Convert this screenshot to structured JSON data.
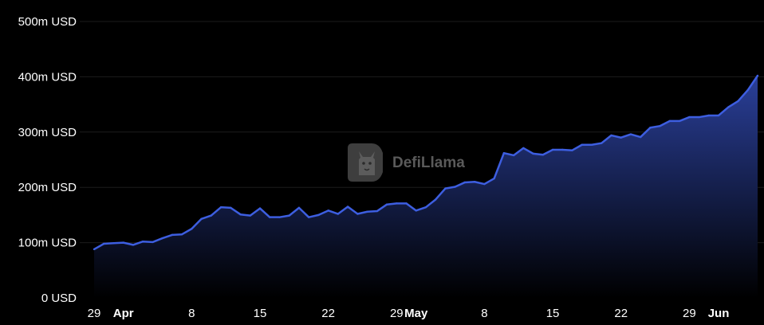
{
  "watermark": {
    "text": "DefiLlama",
    "icon": "llama-logo-icon"
  },
  "colors": {
    "background": "#000000",
    "line": "#3d5ee0",
    "area_top": "#2a3f99",
    "area_bottom": "#000000",
    "text": "#ffffff",
    "grid": "#1c1c1c"
  },
  "chart_data": {
    "type": "area",
    "title": "",
    "xlabel": "",
    "ylabel": "",
    "unit": "USD",
    "ylim": [
      0,
      500
    ],
    "yticks": [
      "0 USD",
      "100m USD",
      "200m USD",
      "300m USD",
      "400m USD",
      "500m USD"
    ],
    "ytick_values": [
      0,
      100,
      200,
      300,
      400,
      500
    ],
    "xticks": [
      {
        "label": "29",
        "day": 0,
        "bold": false
      },
      {
        "label": "Apr",
        "day": 3,
        "bold": true
      },
      {
        "label": "8",
        "day": 10,
        "bold": false
      },
      {
        "label": "15",
        "day": 17,
        "bold": false
      },
      {
        "label": "22",
        "day": 24,
        "bold": false
      },
      {
        "label": "29",
        "day": 31,
        "bold": false
      },
      {
        "label": "May",
        "day": 33,
        "bold": true
      },
      {
        "label": "8",
        "day": 40,
        "bold": false
      },
      {
        "label": "15",
        "day": 47,
        "bold": false
      },
      {
        "label": "22",
        "day": 54,
        "bold": false
      },
      {
        "label": "29",
        "day": 61,
        "bold": false
      },
      {
        "label": "Jun",
        "day": 64,
        "bold": true
      }
    ],
    "grid": true,
    "x_start": "Mar 29",
    "x_end": "Jun 7",
    "series": [
      {
        "values": [
          88,
          98,
          99,
          100,
          96,
          102,
          101,
          108,
          114,
          115,
          125,
          143,
          149,
          164,
          163,
          151,
          149,
          162,
          146,
          146,
          149,
          163,
          146,
          150,
          158,
          152,
          165,
          152,
          156,
          157,
          169,
          171,
          171,
          158,
          164,
          178,
          198,
          201,
          209,
          210,
          206,
          216,
          262,
          258,
          271,
          261,
          259,
          268,
          268,
          267,
          277,
          277,
          280,
          294,
          290,
          296,
          291,
          308,
          311,
          320,
          320,
          327,
          327,
          330,
          330,
          345,
          356,
          376,
          402
        ]
      }
    ]
  }
}
